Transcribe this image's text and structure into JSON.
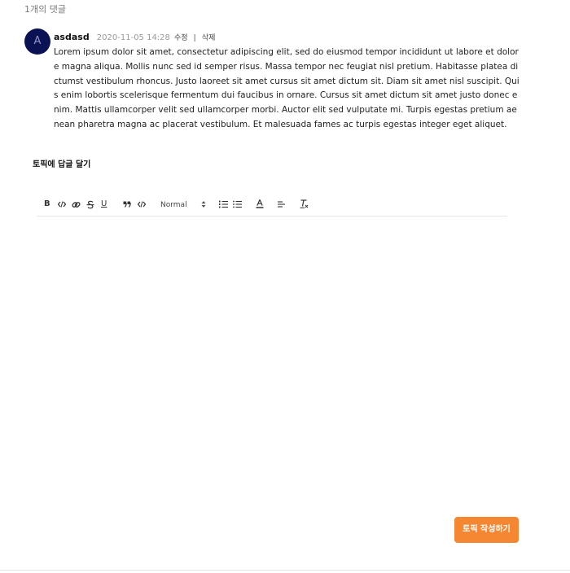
{
  "comments_header": {
    "count_label": "1개의 댓글"
  },
  "comment": {
    "avatar_letter": "A",
    "author": "asdasd",
    "timestamp": "2020-11-05 14:28",
    "edit_label": "수정",
    "separator": "|",
    "delete_label": "삭제",
    "body": "Lorem ipsum dolor sit amet, consectetur adipiscing elit, sed do eiusmod tempor incididunt ut labore et dolore magna aliqua. Mollis nunc sed id semper risus. Massa tempor nec feugiat nisl pretium. Habitasse platea dictumst vestibulum rhoncus. Justo laoreet sit amet cursus sit amet dictum sit. Diam sit amet nisl suscipit. Quis enim lobortis scelerisque fermentum dui faucibus in ornare. Cursus sit amet dictum sit amet justo donec enim. Mattis ullamcorper velit sed ullamcorper morbi. Auctor elit sed vulputate mi. Turpis egestas pretium aenean pharetra magna ac placerat vestibulum. Et malesuada fames ac turpis egestas integer eget aliquet."
  },
  "reply": {
    "title": "토픽에 답글 달기",
    "toolbar": {
      "bold": "B",
      "underline": "U",
      "header_select_value": "Normal",
      "icons": [
        "bold-icon",
        "code-icon",
        "link-icon",
        "strike-icon",
        "underline-icon",
        "blockquote-icon",
        "code-block-icon",
        "header-select",
        "ordered-list-icon",
        "bullet-list-icon",
        "text-color-icon",
        "align-icon",
        "clear-format-icon"
      ]
    },
    "submit_label": "토픽 작성하기"
  },
  "colors": {
    "accent": "#f58632",
    "avatar_bg": "#0b1253"
  }
}
